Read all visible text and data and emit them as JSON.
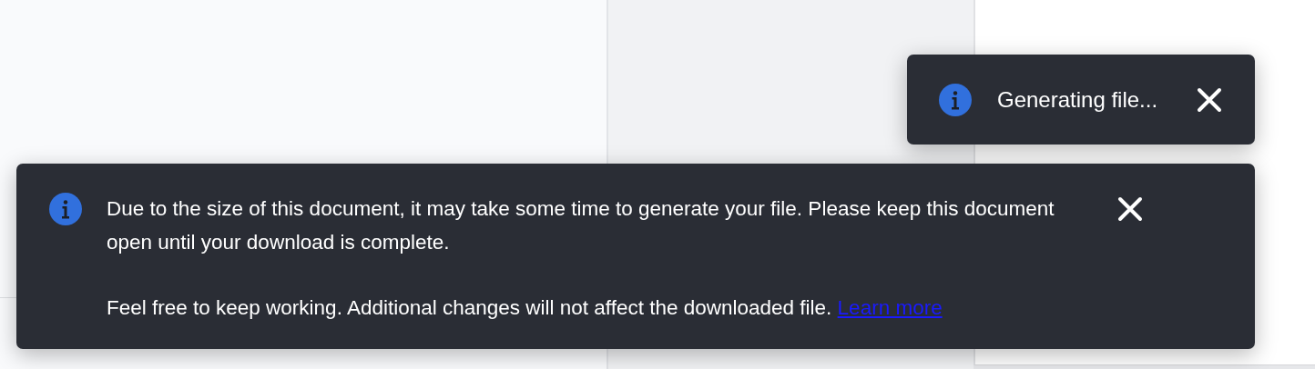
{
  "toasts": [
    {
      "kind": "compact",
      "paragraphs": [
        {
          "text": "Generating file..."
        }
      ]
    },
    {
      "kind": "detailed",
      "paragraphs": [
        {
          "text": "Due to the size of this document, it may take some time to generate your file. Please keep this document open until your download is complete."
        },
        {
          "text": "Feel free to keep working. Additional changes will not affect the downloaded file.",
          "link": "Learn more"
        }
      ]
    }
  ]
}
